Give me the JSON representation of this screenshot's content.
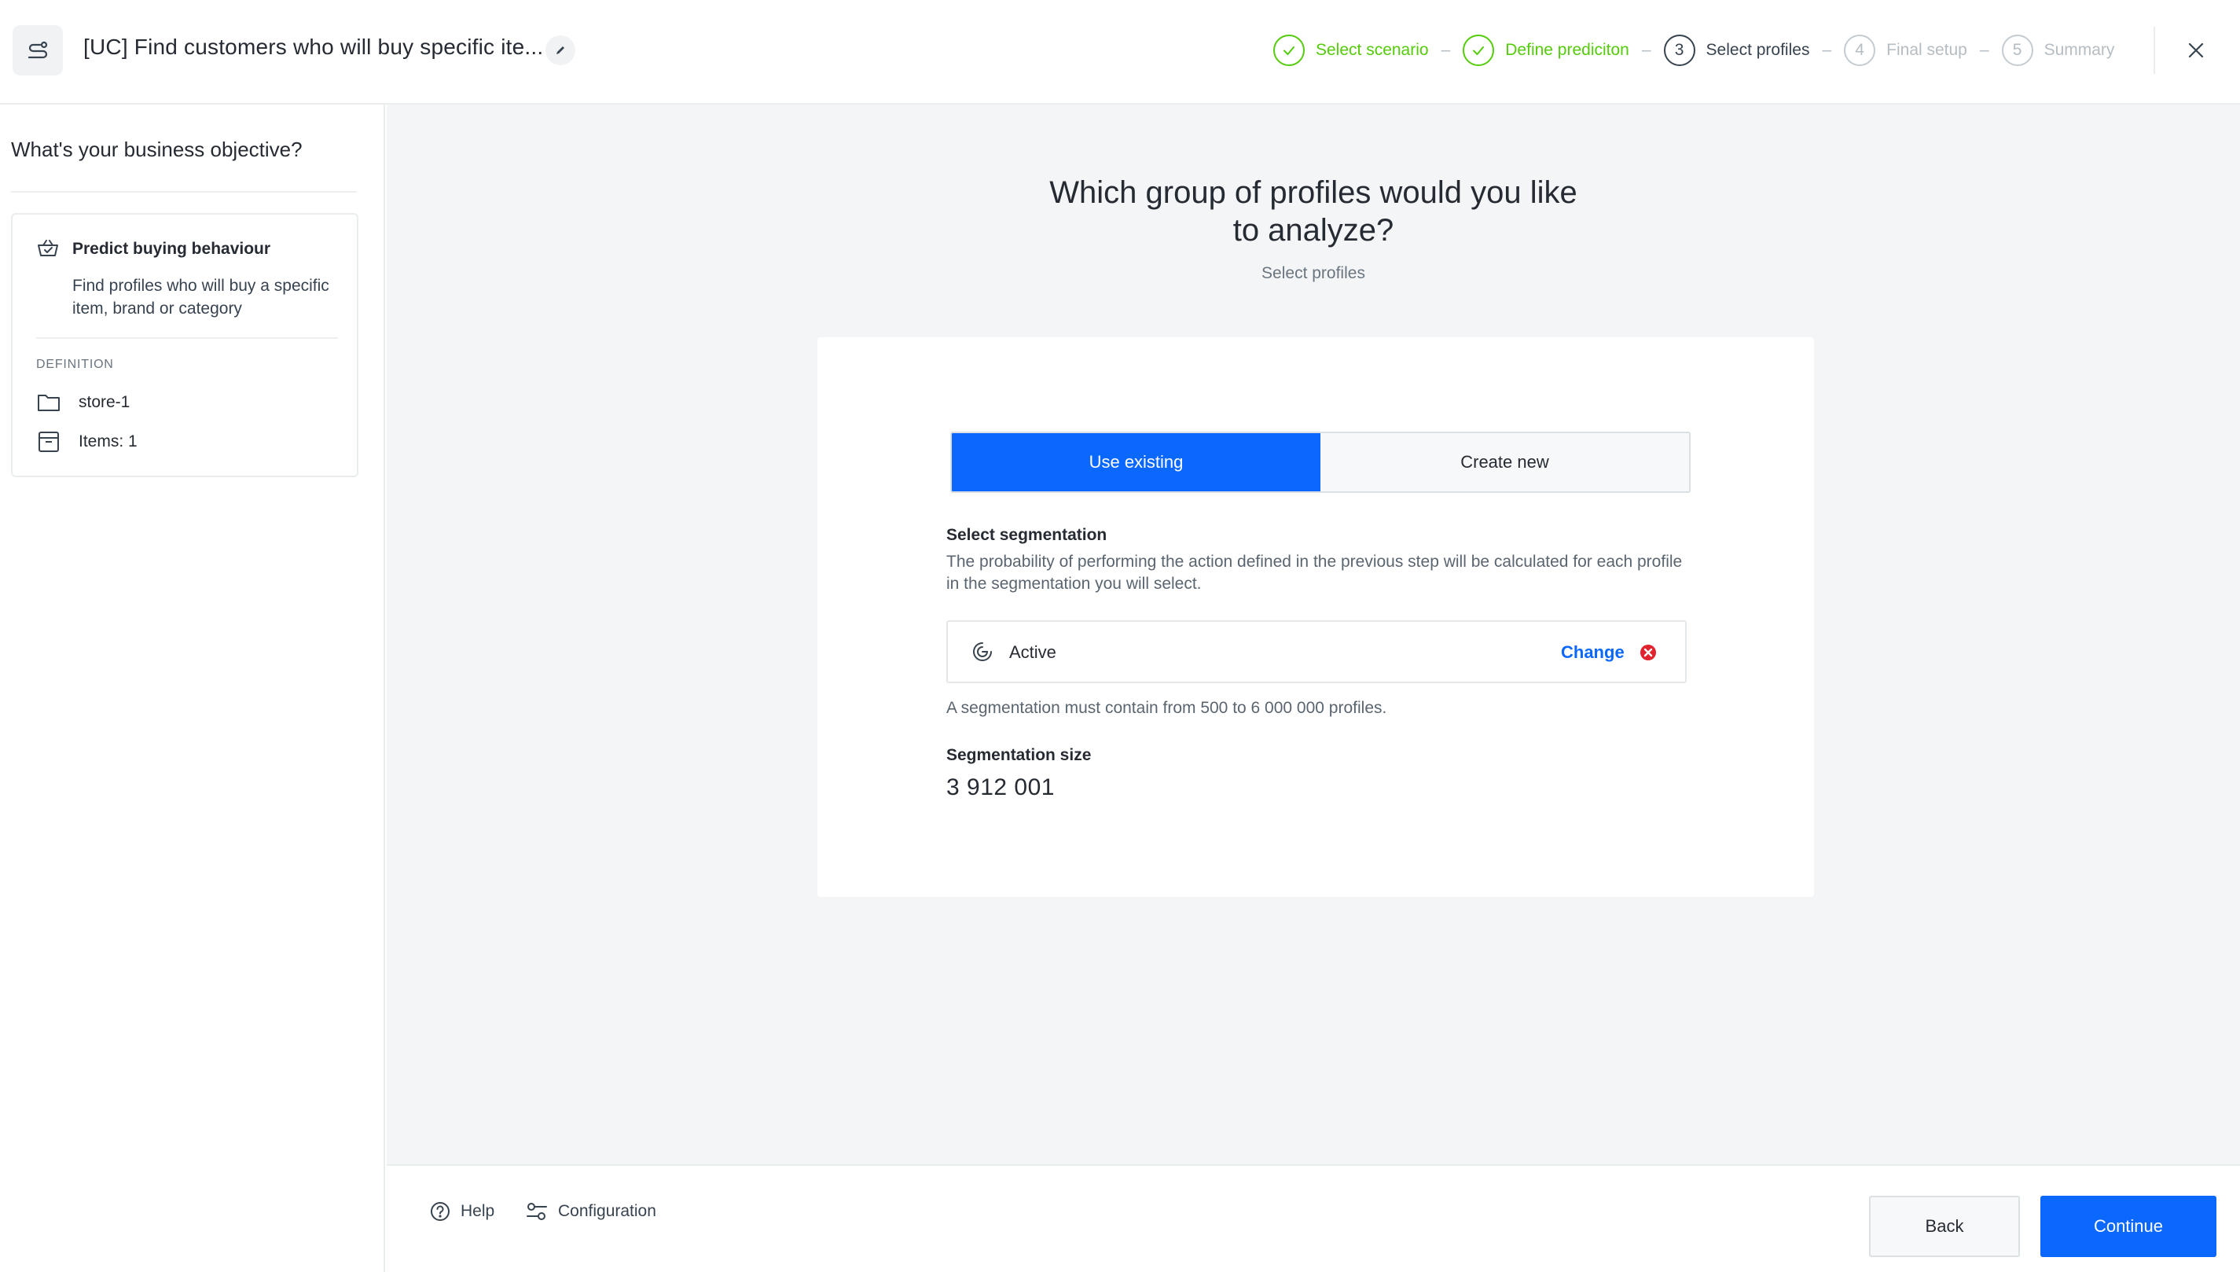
{
  "header": {
    "app_icon": "flow-icon",
    "title": "[UC] Find customers who will buy specific ite...",
    "edit_icon": "pencil-icon",
    "steps": [
      {
        "number": "1",
        "label": "Select scenario",
        "state": "done"
      },
      {
        "number": "2",
        "label": "Define prediciton",
        "state": "done"
      },
      {
        "number": "3",
        "label": "Select profiles",
        "state": "current"
      },
      {
        "number": "4",
        "label": "Final setup",
        "state": "future"
      },
      {
        "number": "5",
        "label": "Summary",
        "state": "future"
      }
    ],
    "step_separator": "–",
    "close_icon": "close-icon"
  },
  "sidebar": {
    "heading": "What's your business objective?",
    "objective": {
      "icon": "basket-icon",
      "title": "Predict buying behaviour",
      "description": "Find profiles who will buy a specific item, brand or category"
    },
    "definition_label": "DEFINITION",
    "definition_items": [
      {
        "icon": "folder-icon",
        "label": "store-1"
      },
      {
        "icon": "catalog-icon",
        "label": "Items: 1"
      }
    ]
  },
  "main": {
    "title": "Which group of profiles would you like to analyze?",
    "subtitle": "Select profiles",
    "toggle": {
      "active": "Use existing",
      "inactive": "Create new"
    },
    "segmentation_label": "Select segmentation",
    "segmentation_description": "The probability of performing the action defined in the previous step will be calculated for each profile in the segmentation you will select.",
    "selected_segmentation": "Active",
    "change_label": "Change",
    "segmentation_note": "A segmentation must contain from 500 to 6 000 000 profiles.",
    "size_label": "Segmentation size",
    "size_value": "3 912 001"
  },
  "footer": {
    "help_label": "Help",
    "configuration_label": "Configuration",
    "back_label": "Back",
    "continue_label": "Continue"
  },
  "colors": {
    "accent": "#0b68ff",
    "done_green": "#54cb0b",
    "danger": "#e0232e",
    "background": "#f4f5f6"
  }
}
